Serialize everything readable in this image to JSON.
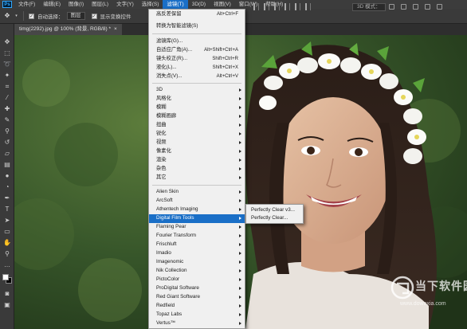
{
  "menubar": {
    "items": [
      "文件(F)",
      "编辑(E)",
      "图像(I)",
      "图层(L)",
      "文字(Y)",
      "选择(S)",
      "滤镜(T)",
      "3D(D)",
      "视图(V)",
      "窗口(W)",
      "帮助(H)"
    ],
    "active": "滤镜(T)"
  },
  "options": {
    "auto_select_label": "自动选择：",
    "auto_select_value": "图层",
    "show_transform_label": "显示变换控件",
    "mode_3d_label": "3D 模式："
  },
  "document": {
    "tab_label": "timg(2292).jpg @ 100% (背景, RGB/8) *",
    "close": "×"
  },
  "filter_menu": {
    "top_items": [
      {
        "label": "高反差保留",
        "shortcut": "Alt+Ctrl+F"
      },
      {
        "label": "转换为智能滤镜(S)",
        "shortcut": ""
      }
    ],
    "special_items": [
      {
        "label": "滤镜库(G)...",
        "shortcut": ""
      },
      {
        "label": "自适应广角(A)...",
        "shortcut": "Alt+Shift+Ctrl+A"
      },
      {
        "label": "镜头校正(R)...",
        "shortcut": "Shift+Ctrl+R"
      },
      {
        "label": "液化(L)...",
        "shortcut": "Shift+Ctrl+X"
      },
      {
        "label": "消失点(V)...",
        "shortcut": "Alt+Ctrl+V"
      }
    ],
    "groups": [
      "3D",
      "风格化",
      "模糊",
      "模糊画廊",
      "扭曲",
      "锐化",
      "视频",
      "像素化",
      "渲染",
      "杂色",
      "其它"
    ],
    "plugins": [
      "Alien Skin",
      "ArcSoft",
      "Athentech Imaging",
      "Digital Film Tools",
      "Flaming Pear",
      "Fourier Transform",
      "Frischluft",
      "Imadio",
      "Imagenomic",
      "Nik Collection",
      "PictoColor",
      "ProDigital Software",
      "Red Giant Software",
      "Redfield",
      "Topaz Labs",
      "Vertus™"
    ],
    "highlighted": "Digital Film Tools"
  },
  "submenu": {
    "items": [
      "Perfectly Clear v3...",
      "Perfectly Clear..."
    ]
  },
  "watermark": {
    "text": "当下软件园",
    "url": "www.downxia.com"
  }
}
